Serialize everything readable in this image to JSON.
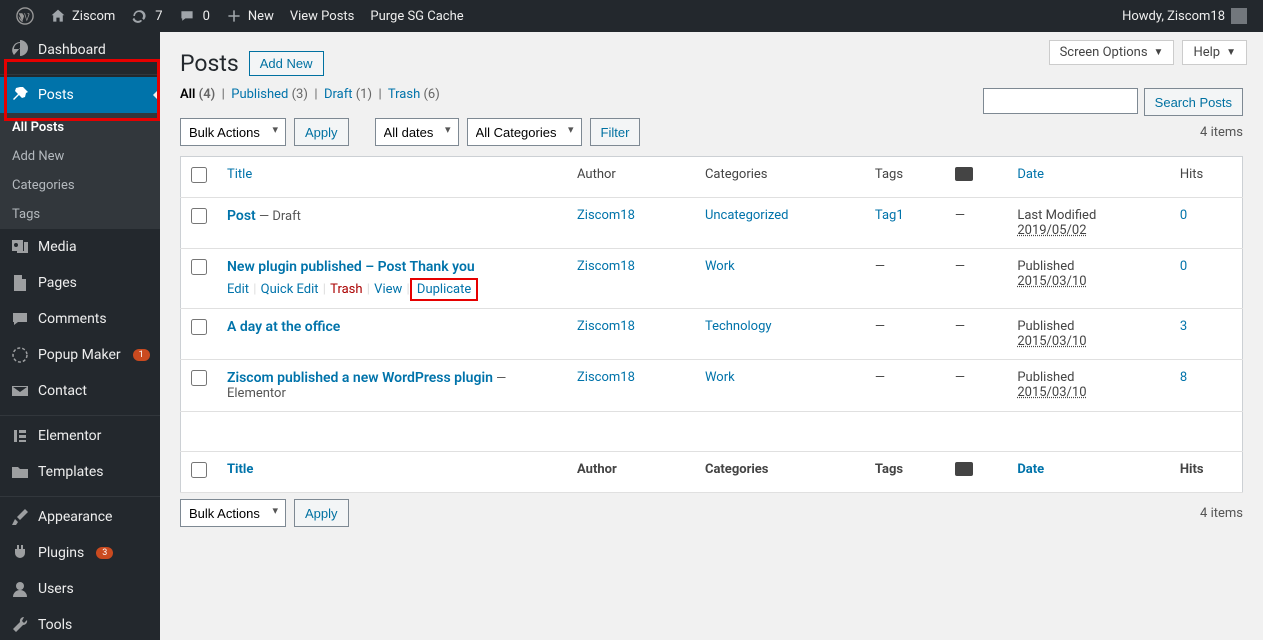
{
  "admin_bar": {
    "site_name": "Ziscom",
    "updates_count": "7",
    "comments_count": "0",
    "new_label": "New",
    "view_posts": "View Posts",
    "purge_cache": "Purge SG Cache",
    "howdy": "Howdy, Ziscom18"
  },
  "sidebar": {
    "dashboard": "Dashboard",
    "posts": "Posts",
    "submenu": {
      "all_posts": "All Posts",
      "add_new": "Add New",
      "categories": "Categories",
      "tags": "Tags"
    },
    "media": "Media",
    "pages": "Pages",
    "comments": "Comments",
    "popup_maker": "Popup Maker",
    "popup_badge": "1",
    "contact": "Contact",
    "elementor": "Elementor",
    "templates": "Templates",
    "appearance": "Appearance",
    "plugins": "Plugins",
    "plugins_badge": "3",
    "users": "Users",
    "tools": "Tools"
  },
  "screen": {
    "options": "Screen Options",
    "help": "Help"
  },
  "page": {
    "title": "Posts",
    "add_new": "Add New"
  },
  "filters": {
    "all": "All",
    "all_count": "(4)",
    "published": "Published",
    "published_count": "(3)",
    "draft": "Draft",
    "draft_count": "(1)",
    "trash": "Trash",
    "trash_count": "(6)"
  },
  "search": {
    "button": "Search Posts"
  },
  "bulk": {
    "bulk_actions": "Bulk Actions",
    "apply": "Apply",
    "all_dates": "All dates",
    "all_categories": "All Categories",
    "filter": "Filter"
  },
  "table": {
    "items_count": "4 items",
    "col_title": "Title",
    "col_author": "Author",
    "col_categories": "Categories",
    "col_tags": "Tags",
    "col_date": "Date",
    "col_hits": "Hits",
    "actions": {
      "edit": "Edit",
      "quick_edit": "Quick Edit",
      "trash": "Trash",
      "view": "View",
      "duplicate": "Duplicate"
    },
    "rows": [
      {
        "title": "Post",
        "state": " — Draft",
        "author": "Ziscom18",
        "categories": "Uncategorized",
        "tags": "Tag1",
        "comments": "—",
        "date_status": "Last Modified",
        "date": "2019/05/02",
        "hits": "0"
      },
      {
        "title": "New plugin published – Post Thank you",
        "state": "",
        "author": "Ziscom18",
        "categories": "Work",
        "tags": "—",
        "comments": "—",
        "date_status": "Published",
        "date": "2015/03/10",
        "hits": "0"
      },
      {
        "title": "A day at the office",
        "state": "",
        "author": "Ziscom18",
        "categories": "Technology",
        "tags": "—",
        "comments": "—",
        "date_status": "Published",
        "date": "2015/03/10",
        "hits": "3"
      },
      {
        "title": "Ziscom published a new WordPress plugin",
        "state": " — Elementor",
        "author": "Ziscom18",
        "categories": "Work",
        "tags": "—",
        "comments": "—",
        "date_status": "Published",
        "date": "2015/03/10",
        "hits": "8"
      }
    ]
  }
}
